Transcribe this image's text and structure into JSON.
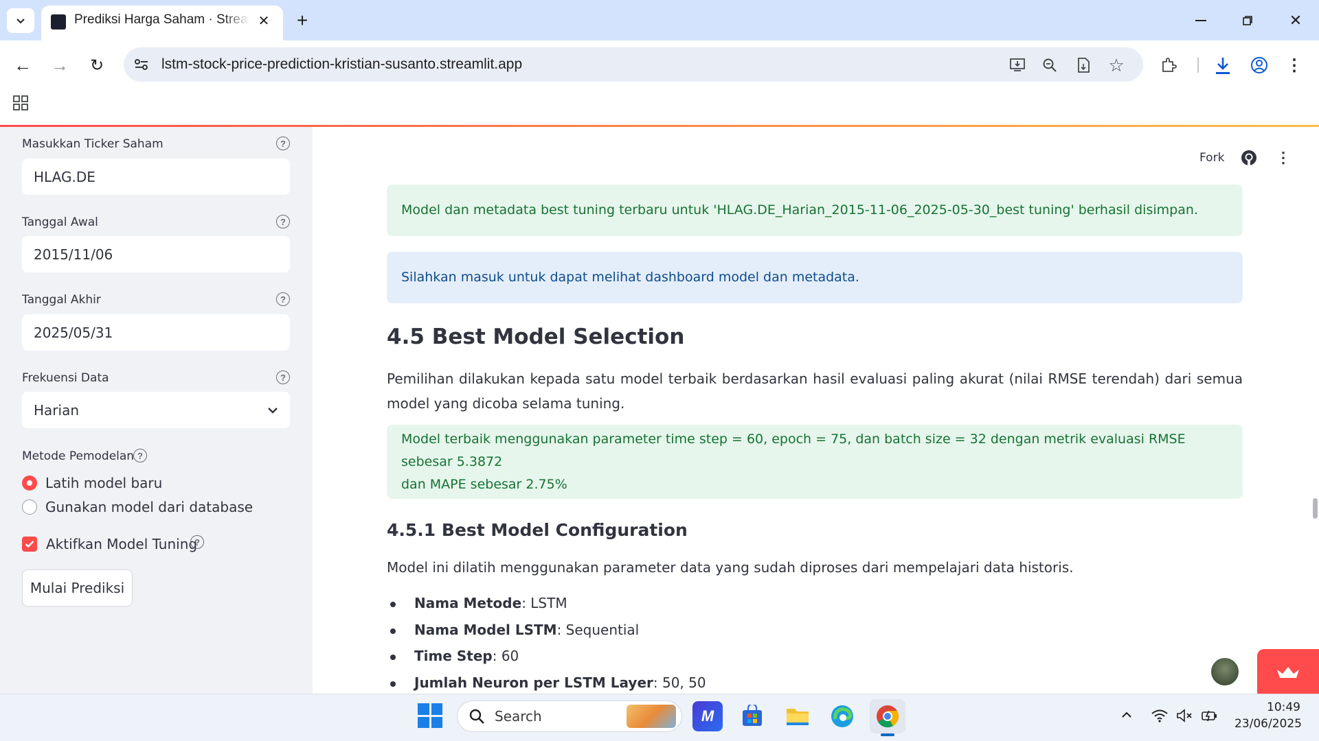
{
  "browser": {
    "tab_title": "Prediksi Harga Saham · Streamlit",
    "url": "lstm-stock-price-prediction-kristian-susanto.streamlit.app"
  },
  "sidebar": {
    "ticker_label": "Masukkan Ticker Saham",
    "ticker_value": "HLAG.DE",
    "start_label": "Tanggal Awal",
    "start_value": "2015/11/06",
    "end_label": "Tanggal Akhir",
    "end_value": "2025/05/31",
    "freq_label": "Frekuensi Data",
    "freq_value": "Harian",
    "method_label": "Metode Pemodelan",
    "method_options": [
      "Latih model baru",
      "Gunakan model dari database"
    ],
    "method_selected": "Latih model baru",
    "tuning_label": "Aktifkan Model Tuning",
    "tuning_checked": true,
    "predict_button": "Mulai Prediksi"
  },
  "header": {
    "fork_label": "Fork"
  },
  "main": {
    "success_message": "Model dan metadata best tuning terbaru untuk 'HLAG.DE_Harian_2015-11-06_2025-05-30_best tuning' berhasil disimpan.",
    "info_message": "Silahkan masuk untuk dapat melihat dashboard model dan metadata.",
    "section_title": "4.5 Best Model Selection",
    "section_desc": "Pemilihan dilakukan kepada satu model terbaik berdasarkan hasil evaluasi paling akurat (nilai RMSE terendah) dari semua model yang dicoba selama tuning.",
    "best_model_line1": "Model terbaik menggunakan parameter time step = 60, epoch = 75, dan batch size = 32 dengan metrik evaluasi RMSE sebesar 5.3872",
    "best_model_line2": "dan MAPE sebesar 2.75%",
    "subsection_title": "4.5.1 Best Model Configuration",
    "subsection_desc": "Model ini dilatih menggunakan parameter data yang sudah diproses dari mempelajari data historis.",
    "config": [
      {
        "key": "Nama Metode",
        "value": ": LSTM"
      },
      {
        "key": "Nama Model LSTM",
        "value": ": Sequential"
      },
      {
        "key": "Time Step",
        "value": ": 60"
      },
      {
        "key": "Jumlah Neuron per LSTM Layer",
        "value": ": 50, 50"
      }
    ]
  },
  "taskbar": {
    "search_placeholder": "Search",
    "time": "10:49",
    "date": "23/06/2025"
  },
  "colors": {
    "accent": "#ff4b4b",
    "success_bg": "#e6f6ec",
    "info_bg": "#e4eefb"
  }
}
